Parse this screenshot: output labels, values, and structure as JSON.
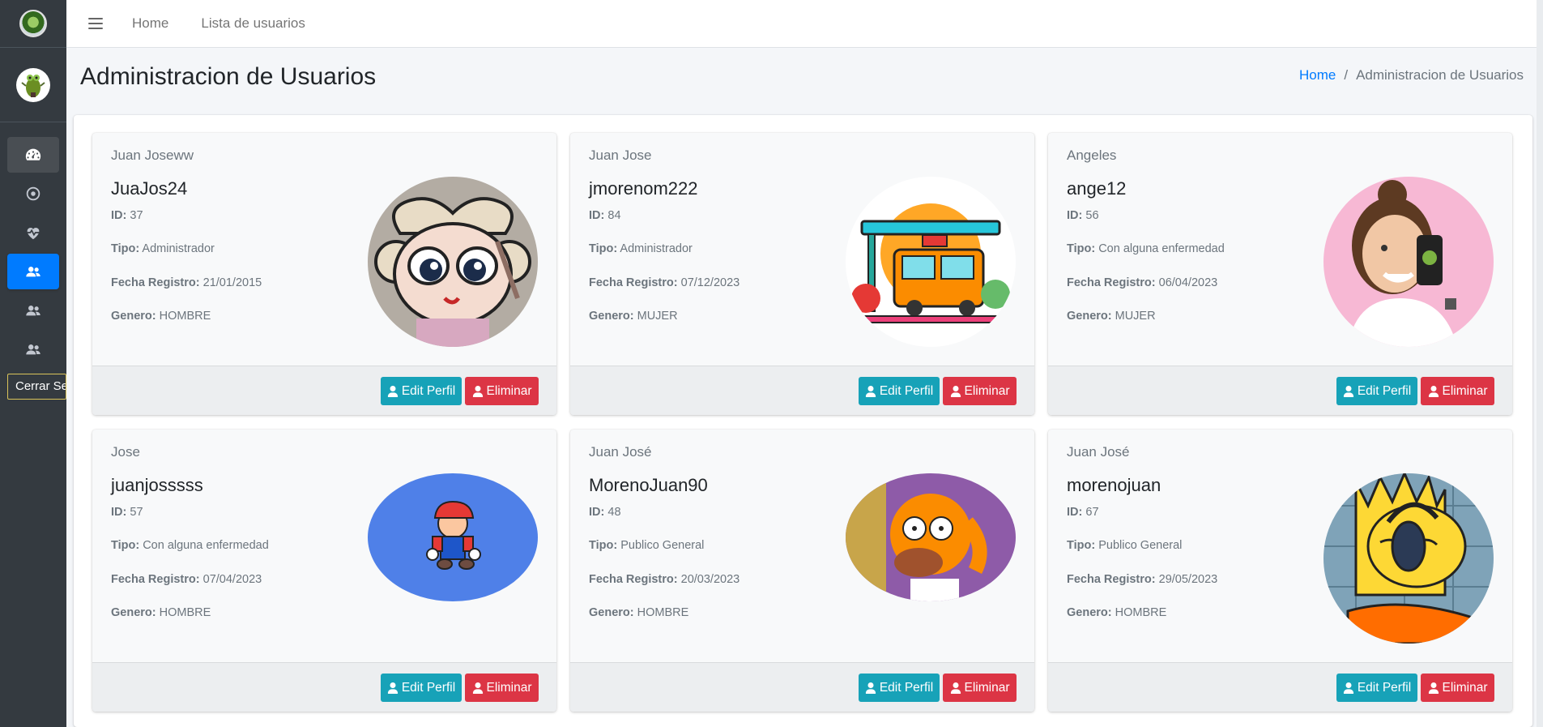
{
  "nav": {
    "links": [
      "Home",
      "Lista de usuarios"
    ]
  },
  "sidebar": {
    "tooltip": "Cerrar Sesión"
  },
  "header": {
    "title": "Administracion de Usuarios",
    "breadcrumb_home": "Home",
    "breadcrumb_sep": "/",
    "breadcrumb_current": "Administracion de Usuarios"
  },
  "labels": {
    "id": "ID:",
    "tipo": "Tipo:",
    "fecha": "Fecha Registro:",
    "genero": "Genero:",
    "edit": "Edit Perfil",
    "delete": "Eliminar"
  },
  "users": [
    {
      "name": "Juan Joseww",
      "username": "JuaJos24",
      "id": "37",
      "tipo": "Administrador",
      "fecha": "21/01/2015",
      "genero": "HOMBRE",
      "photo": "powerpuff-girl-avatar"
    },
    {
      "name": "Juan Jose",
      "username": "jmorenom222",
      "id": "84",
      "tipo": "Administrador",
      "fecha": "07/12/2023",
      "genero": "MUJER",
      "photo": "bus-stop-avatar"
    },
    {
      "name": "Angeles",
      "username": "ange12",
      "id": "56",
      "tipo": "Con alguna enfermedad",
      "fecha": "06/04/2023",
      "genero": "MUJER",
      "photo": "woman-phone-avatar"
    },
    {
      "name": "Jose",
      "username": "juanjosssss",
      "id": "57",
      "tipo": "Con alguna enfermedad",
      "fecha": "07/04/2023",
      "genero": "HOMBRE",
      "photo": "mario-avatar"
    },
    {
      "name": "Juan José",
      "username": "MorenoJuan90",
      "id": "48",
      "tipo": "Publico General",
      "fecha": "20/03/2023",
      "genero": "HOMBRE",
      "photo": "homer-avatar"
    },
    {
      "name": "Juan José",
      "username": "morenojuan",
      "id": "67",
      "tipo": "Publico General",
      "fecha": "29/05/2023",
      "genero": "HOMBRE",
      "photo": "bart-headphones-avatar"
    }
  ],
  "colors": {
    "primary": "#007bff",
    "info": "#17a2b8",
    "danger": "#dc3545",
    "sidebar": "#343a40"
  }
}
